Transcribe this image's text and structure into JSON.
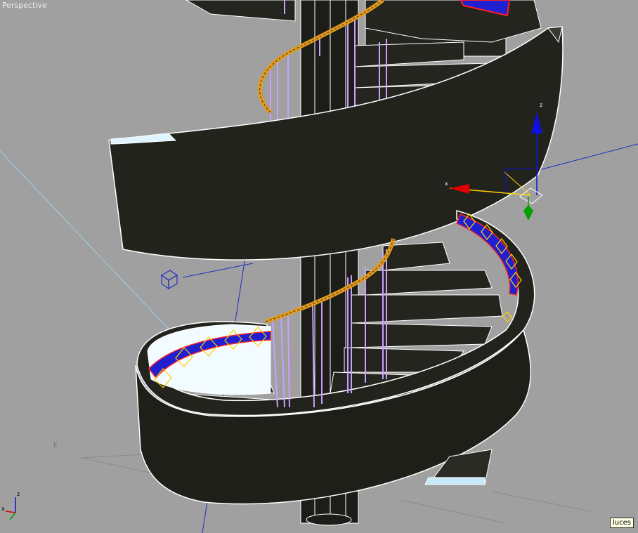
{
  "viewport": {
    "label": "Perspective",
    "compass_label": "E",
    "tooltip": "luces",
    "gizmo": {
      "x_label": "x",
      "z_label": "z"
    },
    "axis_tripod": {
      "x_label": "x",
      "z_label": "z"
    }
  },
  "colors": {
    "background": "#a0a0a0",
    "stair_body": "#22221c",
    "edge": "#ffffff",
    "rail_outline": "#c9a0ff",
    "handrail": "#e09a1e",
    "inner_band": "#2020d0",
    "light_gizmo": "#ffd200",
    "axis_x": "#e00000",
    "axis_y": "#00a000",
    "axis_z": "#1010e0"
  }
}
